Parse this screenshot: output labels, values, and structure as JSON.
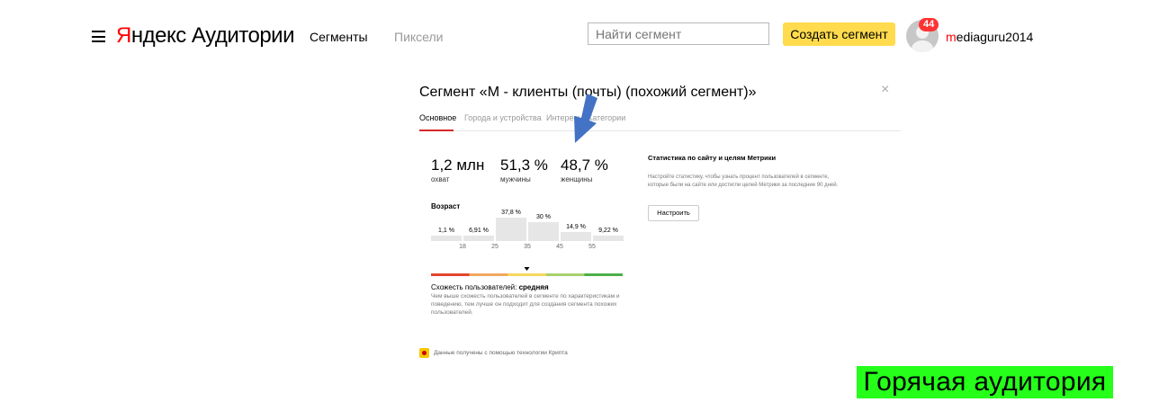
{
  "header": {
    "logo_brand": "Яндекс",
    "logo_product": "Аудитории",
    "nav": [
      "Сегменты",
      "Пиксели"
    ],
    "search_placeholder": "Найти сегмент",
    "create_label": "Создать сегмент",
    "notifications": "44",
    "username": "mediaguru2014"
  },
  "modal": {
    "title": "Сегмент «М - клиенты (почты) (похожий сегмент)»",
    "close": "×",
    "tabs": [
      "Основное",
      "Города и устройства",
      "Интересы",
      "Категории"
    ],
    "active_tab": 0,
    "stats": [
      {
        "value": "1,2 млн",
        "label": "охват"
      },
      {
        "value": "51,3 %",
        "label": "мужчины"
      },
      {
        "value": "48,7 %",
        "label": "женщины"
      }
    ],
    "age_title": "Возраст",
    "chart_data": {
      "type": "bar",
      "title": "Возраст",
      "categories": [
        "<18",
        "18-25",
        "25-35",
        "35-45",
        "45-55",
        "55+"
      ],
      "values": [
        1.1,
        6.91,
        37.8,
        30,
        14.9,
        9.22
      ],
      "data_labels": [
        "1,1 %",
        "6,91 %",
        "37,8 %",
        "30 %",
        "14,9 %",
        "9,22 %"
      ],
      "tick_labels": [
        "18",
        "25",
        "35",
        "45",
        "55"
      ],
      "bar_color": "#e6e6e6"
    },
    "similarity": {
      "label": "Схожесть пользователей: ",
      "value": "средняя",
      "description": "Чем выше схожесть пользователей в сегменте по характеристикам и поведению, тем лучше он подходит для создания сегмента похожих пользователей.",
      "scale_colors": [
        "#e3452f",
        "#f0a860",
        "#f7d85d",
        "#a8d16e",
        "#4bb04a"
      ],
      "level": 0.5
    },
    "metrika": {
      "title": "Статистика по сайту и целям Метрики",
      "description": "Настройте статистику, чтобы узнать процент пользователей в сегменте, которые были на сайте или достигли целей Метрики за последние 90 дней.",
      "button": "Настроить"
    },
    "footer": "Данные получены с помощью технологии Крипта"
  },
  "annotation": {
    "text": "Горячая аудитория",
    "background": "#25ff1a",
    "arrow_color": "#4472c4"
  }
}
